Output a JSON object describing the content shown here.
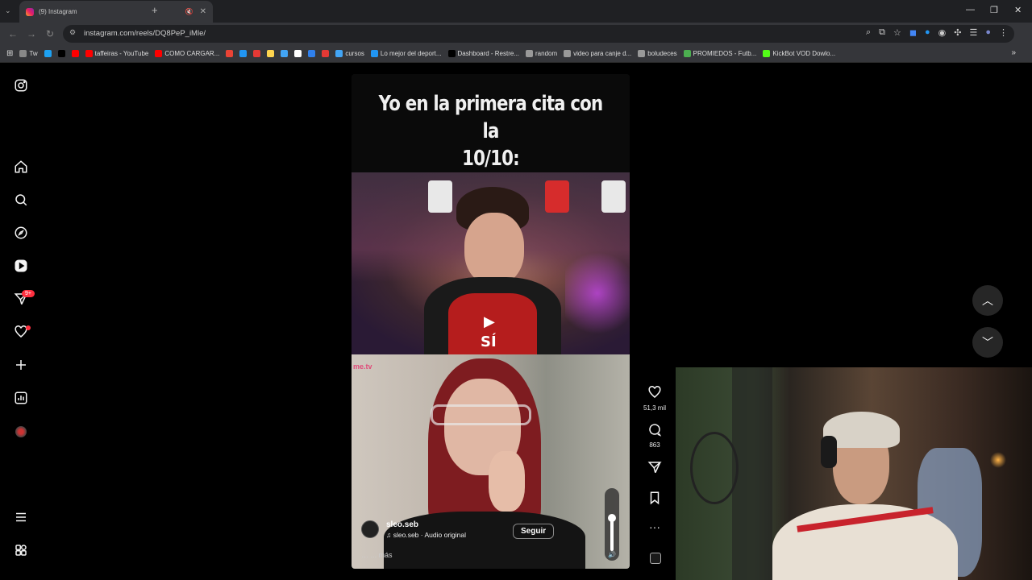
{
  "browser": {
    "tab_title": "(9) Instagram",
    "url": "instagram.com/reels/DQ8PeP_iMle/",
    "bookmarks": [
      {
        "label": "Tw",
        "color": "#888"
      },
      {
        "label": "",
        "color": "#1da1f2"
      },
      {
        "label": "",
        "color": "#000"
      },
      {
        "label": "",
        "color": "#ff0000"
      },
      {
        "label": "taffeiras - YouTube",
        "color": "#ff0000"
      },
      {
        "label": "COMO CARGAR...",
        "color": "#ff0000"
      },
      {
        "label": "",
        "color": "#ea4335"
      },
      {
        "label": "",
        "color": "#2196f3"
      },
      {
        "label": "",
        "color": "#e53935"
      },
      {
        "label": "",
        "color": "#ffd54f"
      },
      {
        "label": "",
        "color": "#42a5f5"
      },
      {
        "label": "",
        "color": "#fff"
      },
      {
        "label": "",
        "color": "#2f80ed"
      },
      {
        "label": "",
        "color": "#e53935"
      },
      {
        "label": "cursos",
        "color": "#42a5f5"
      },
      {
        "label": "Lo mejor del deport...",
        "color": "#2196f3"
      },
      {
        "label": "Dashboard - Restre...",
        "color": "#000"
      },
      {
        "label": "random",
        "color": "#999"
      },
      {
        "label": "video para canje d...",
        "color": "#999"
      },
      {
        "label": "boludeces",
        "color": "#999"
      },
      {
        "label": "PROMIEDOS - Futb...",
        "color": "#4caf50"
      },
      {
        "label": "KickBot VOD Dowlo...",
        "color": "#53fc18"
      }
    ]
  },
  "reel": {
    "caption_line1": "Yo en la primera cita con la",
    "caption_line2": "10/10:",
    "overlay_text": "SÍ",
    "watermark": "me.tv",
    "username": "sleo.seb",
    "audio": "sleo.seb · Audio original",
    "follow_label": "Seguir",
    "more_label": "... más",
    "likes": "51,3 mil",
    "comments": "863"
  },
  "icons": {
    "home": "home-icon",
    "search": "search-icon",
    "explore": "compass-icon",
    "reels": "reels-icon",
    "messages": "send-icon",
    "notifications": "heart-icon",
    "create": "plus-icon",
    "dashboard": "dashboard-icon",
    "more": "menu-icon",
    "also_from_meta": "grid-icon"
  },
  "badges": {
    "messages_count": "9+"
  },
  "colors": {
    "accent_red": "#ff3040",
    "background": "#000000"
  }
}
